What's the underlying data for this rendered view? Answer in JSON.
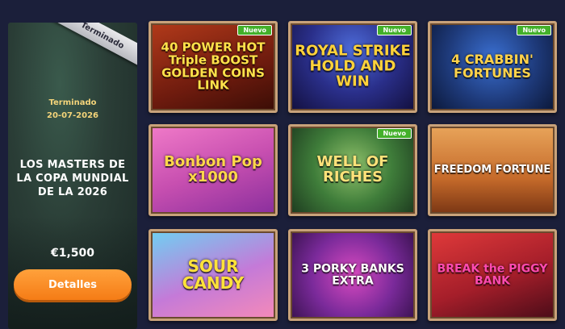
{
  "promo": {
    "ribbon": "Terminado",
    "status": "Terminado",
    "date": "20-07-2026",
    "title": "LOS MASTERS DE LA COPA MUNDIAL DE LA 2026",
    "prize": "€1,500",
    "button_label": "Detalles"
  },
  "games": [
    {
      "name": "40 POWER HOT Triple BOOST GOLDEN COINS LINK",
      "badge": "Nuevo"
    },
    {
      "name": "ROYAL STRIKE HOLD AND WIN",
      "badge": "Nuevo"
    },
    {
      "name": "4 CRABBIN' FORTUNES",
      "badge": "Nuevo"
    },
    {
      "name": "Bonbon Pop x1000",
      "badge": ""
    },
    {
      "name": "WELL OF RICHES",
      "badge": "Nuevo"
    },
    {
      "name": "FREEDOM FORTUNE",
      "badge": ""
    },
    {
      "name": "SOUR CANDY",
      "badge": ""
    },
    {
      "name": "3 PORKY BANKS EXTRA",
      "badge": ""
    },
    {
      "name": "BREAK the PIGGY BANK",
      "badge": ""
    }
  ],
  "colors": {
    "background": "#1b1f3a",
    "button": "#f57c16",
    "badge": "#43b02a",
    "date_text": "#f4d47a",
    "tile_frame": "#c8a27a"
  }
}
